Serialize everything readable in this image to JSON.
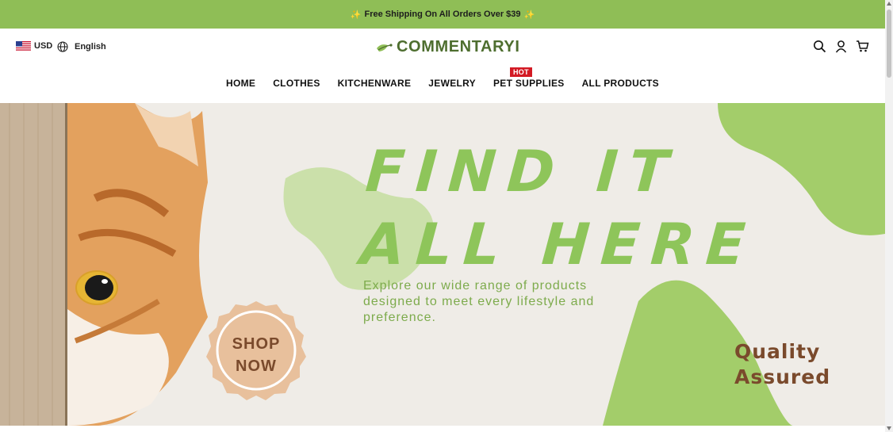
{
  "announcement": {
    "text": "Free Shipping On All Orders Over $39",
    "icon": "sparkle-icon"
  },
  "header": {
    "currency": "USD",
    "language": "English",
    "logo_text": "COMMENTARYI",
    "icons": [
      "search-icon",
      "account-icon",
      "cart-icon"
    ]
  },
  "nav": {
    "items": [
      {
        "label": "HOME"
      },
      {
        "label": "CLOTHES"
      },
      {
        "label": "KITCHENWARE"
      },
      {
        "label": "JEWELRY"
      },
      {
        "label": "PET SUPPLIES",
        "badge": "HOT"
      },
      {
        "label": "ALL PRODUCTS"
      }
    ]
  },
  "hero": {
    "headline_line1": "FIND IT",
    "headline_line2": "ALL HERE",
    "subtitle": "Explore our wide range of products designed to meet every lifestyle and preference.",
    "shop_line1": "SHOP",
    "shop_line2": "NOW",
    "quality_line1": "Quality",
    "quality_line2": "Assured"
  },
  "colors": {
    "accent_green": "#8fbe56",
    "blob_green": "#a3cd6a",
    "badge_red": "#d31a24",
    "brown": "#7a4a2c",
    "peach": "#e8c09c"
  }
}
